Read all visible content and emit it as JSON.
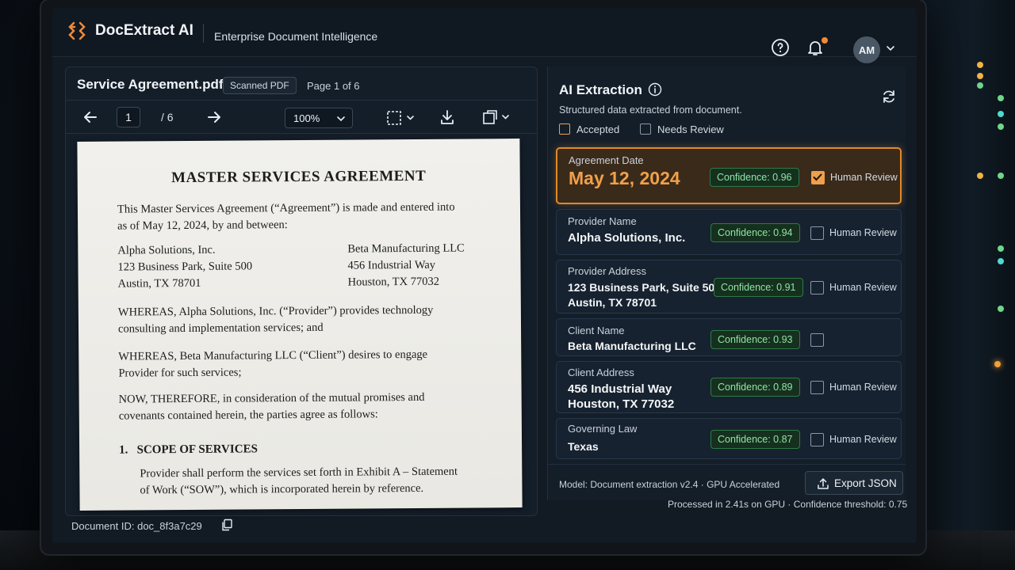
{
  "app": {
    "name": "DocExtract AI",
    "subtitle": "Enterprise Document Intelligence",
    "user_initials": "AM",
    "icons": [
      "help-icon",
      "bell-icon",
      "chevron-down-icon"
    ]
  },
  "document": {
    "filename": "Service Agreement.pdf",
    "badge": "Scanned PDF",
    "page_info": "Page 1 of 6",
    "current_page": "1",
    "page_total": "/ 6",
    "zoom": "100%",
    "document_id": "Document ID: doc_8f3a7c29",
    "paper": {
      "title": "MASTER SERVICES AGREEMENT",
      "intro_1": "This Master Services Agreement (“Agreement”) is made and entered into",
      "intro_2": "as of May 12, 2024, by and between:",
      "provider_line1": "Alpha Solutions, Inc.",
      "provider_line2": "123 Business Park, Suite 500",
      "provider_line3": "Austin, TX 78701",
      "client_line1": "Beta Manufacturing LLC",
      "client_line2": "456 Industrial Way",
      "client_line3": "Houston, TX 77032",
      "whereas1_1": "WHEREAS, Alpha Solutions, Inc. (“Provider”) provides technology",
      "whereas1_2": "consulting and implementation services; and",
      "whereas2_1": "WHEREAS, Beta Manufacturing LLC (“Client”) desires to engage",
      "whereas2_2": "Provider for such services;",
      "now_1": "NOW, THEREFORE, in consideration of the mutual promises and",
      "now_2": "covenants contained herein, the parties agree as follows:",
      "section_heading": "1.  SCOPE OF SERVICES",
      "section_1": "Provider shall perform the services set forth in Exhibit A – Statement",
      "section_2": "of Work (“SOW”), which is incorporated herein by reference."
    }
  },
  "extraction": {
    "title": "AI Extraction",
    "description": "Structured data extracted from document.",
    "legend_accepted": "Accepted",
    "legend_review": "Needs Review",
    "review_label": "Human Review",
    "fields": [
      {
        "label": "Agreement Date",
        "value": "May 12, 2024",
        "confidence": "Confidence: 0.96",
        "review_checked": true
      },
      {
        "label": "Provider Name",
        "value": "Alpha Solutions, Inc.",
        "confidence": "Confidence: 0.94",
        "review_checked": false
      },
      {
        "label": "Provider Address",
        "value_1": "123 Business Park, Suite 500",
        "value_2": "Austin, TX 78701",
        "confidence": "Confidence: 0.91",
        "review_checked": false
      },
      {
        "label": "Client Name",
        "value": "Beta Manufacturing LLC",
        "confidence": "Confidence: 0.93",
        "review_checked": false
      },
      {
        "label": "Client Address",
        "value_1": "456 Industrial Way",
        "value_2": "Houston, TX 77032",
        "confidence": "Confidence: 0.89",
        "review_checked": false
      },
      {
        "label": "Governing Law",
        "value": "Texas",
        "confidence": "Confidence: 0.87",
        "review_checked": false
      }
    ],
    "model_info": "Model: Document extraction v2.4 · GPU Accelerated",
    "export_label": "Export JSON",
    "status": "Processed in 2.41s on GPU · Confidence threshold: 0.75"
  },
  "colors": {
    "accent_orange": "#f0a04a",
    "confidence_green": "#8fe3a2",
    "background": "#121a24"
  }
}
